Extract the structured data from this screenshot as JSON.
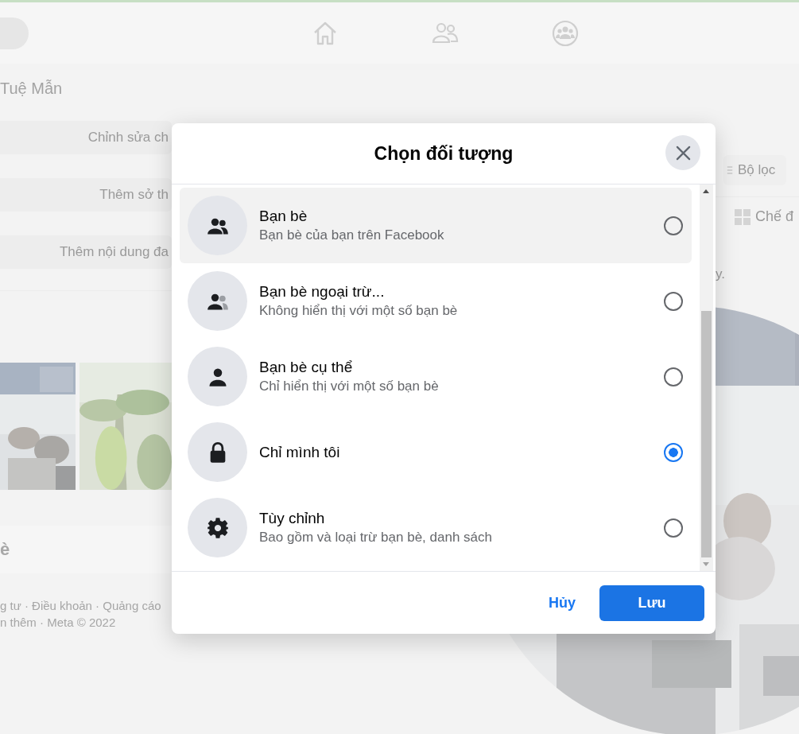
{
  "profile": {
    "name": "Tuệ Mẫn",
    "buttons": [
      "Chỉnh sửa ch",
      "Thêm sở th",
      "Thêm nội dung đa"
    ]
  },
  "friends_card": {
    "heading": "è"
  },
  "footer": [
    "g tư · Điều khoản · Quảng cáo",
    "n thêm · Meta © 2022"
  ],
  "posts_toolbar": {
    "filter_button": "Bộ lọc",
    "view_button": "Chế đ",
    "note": "y."
  },
  "dialog": {
    "title": "Chọn đối tượng",
    "options": [
      {
        "kind": "friends",
        "title": "Bạn bè",
        "subtitle": "Bạn bè của bạn trên Facebook",
        "selected": false,
        "hovered": true
      },
      {
        "kind": "friends_except",
        "title": "Bạn bè ngoại trừ...",
        "subtitle": "Không hiển thị với một số bạn bè",
        "selected": false,
        "hovered": false
      },
      {
        "kind": "specific_friends",
        "title": "Bạn bè cụ thể",
        "subtitle": "Chỉ hiển thị với một số bạn bè",
        "selected": false,
        "hovered": false
      },
      {
        "kind": "only_me",
        "title": "Chỉ mình tôi",
        "selected": true,
        "hovered": false
      },
      {
        "kind": "custom",
        "title": "Tùy chỉnh",
        "subtitle": "Bao gồm và loại trừ bạn bè, danh sách",
        "selected": false,
        "hovered": false
      }
    ],
    "cancel_button": "Hủy",
    "save_button": "Lưu"
  }
}
